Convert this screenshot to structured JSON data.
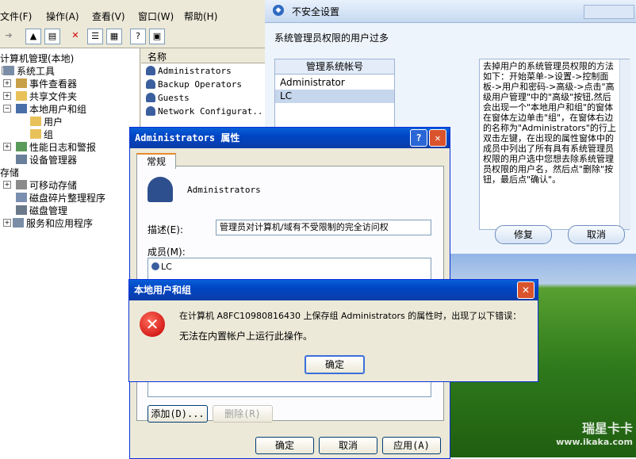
{
  "cm": {
    "menu": [
      "文件(F)",
      "操作(A)",
      "查看(V)",
      "窗口(W)",
      "帮助(H)"
    ],
    "tree": [
      {
        "label": "计算机管理(本地)",
        "level": 0
      },
      {
        "label": "系统工具",
        "level": 1
      },
      {
        "label": "事件查看器",
        "level": 2
      },
      {
        "label": "共享文件夹",
        "level": 2
      },
      {
        "label": "本地用户和组",
        "level": 2
      },
      {
        "label": "用户",
        "level": 3
      },
      {
        "label": "组",
        "level": 3
      },
      {
        "label": "性能日志和警报",
        "level": 2
      },
      {
        "label": "设备管理器",
        "level": 2
      },
      {
        "label": "存储",
        "level": 1
      },
      {
        "label": "可移动存储",
        "level": 2
      },
      {
        "label": "磁盘碎片整理程序",
        "level": 2
      },
      {
        "label": "磁盘管理",
        "level": 2
      },
      {
        "label": "服务和应用程序",
        "level": 1
      }
    ],
    "list_header": "名称",
    "list_items": [
      "Administrators",
      "Backup Operators",
      "Guests",
      "Network Configurat..."
    ]
  },
  "unsafe": {
    "title": "不安全设置",
    "heading": "系统管理员权限的用户过多",
    "table_header": "管理系统帐号",
    "accounts": [
      "Administrator",
      "LC"
    ],
    "help_text": "去掉用户的系统管理员权限的方法如下：开始菜单->设置->控制面板->用户和密码->高级->点击\"高级用户管理\"中的\"高级\"按钮,然后会出现一个\"本地用户和组\"的窗体在窗体左边单击\"组\"，在窗体右边的名称为\"Administrators\"的行上双击左键，在出现的属性窗体中的成员中列出了所有具有系统管理员权限的用户选中您想去除系统管理员权限的用户名，然后点\"删除\"按钮，最后点\"确认\"。",
    "repair_label": "修复",
    "cancel_label": "取消"
  },
  "props": {
    "title": "Administrators 属性",
    "help_btn": "?",
    "close_btn": "✕",
    "tab": "常规",
    "group_name": "Administrators",
    "desc_label": "描述(E):",
    "desc_value": "管理员对计算机/域有不受限制的完全访问权",
    "members_label": "成员(M):",
    "members": [
      "LC"
    ],
    "add_label": "添加(D)...",
    "remove_label": "删除(R)",
    "ok_label": "确定",
    "cancel_label": "取消",
    "apply_label": "应用(A)"
  },
  "error": {
    "title": "本地用户和组",
    "message1": "在计算机 A8FC10980816430 上保存组 Administrators 的属性时，出现了以下错误：",
    "message2": "无法在内置帐户上运行此操作。",
    "ok_label": "确定",
    "close_btn": "✕"
  },
  "watermark": {
    "line1": "瑞星卡卡",
    "line2": "www.ikaka.com"
  }
}
